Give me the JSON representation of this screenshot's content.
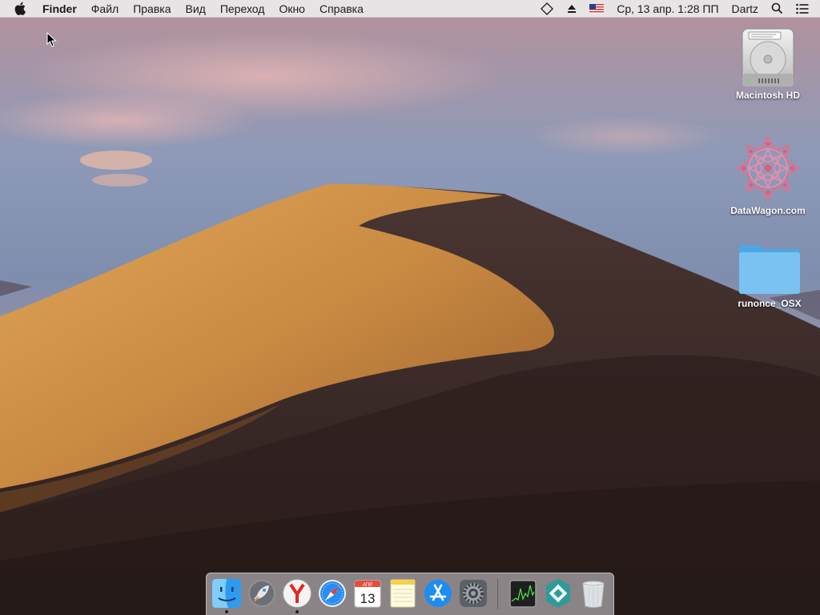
{
  "menubar": {
    "app_name": "Finder",
    "menus": [
      "Файл",
      "Правка",
      "Вид",
      "Переход",
      "Окно",
      "Справка"
    ],
    "status": {
      "datetime": "Ср, 13 апр.  1:28 ПП",
      "user": "Dartz",
      "icons": [
        "diamond-icon",
        "eject-icon",
        "us-flag-icon",
        "search-icon",
        "list-icon"
      ]
    }
  },
  "desktop_icons": [
    {
      "label": "Macintosh HD",
      "icon": "hard-drive-icon"
    },
    {
      "label": "DataWagon.com",
      "icon": "mandala-icon"
    },
    {
      "label": "runonce_OSX",
      "icon": "folder-icon"
    }
  ],
  "dock": {
    "items": [
      "finder",
      "launchpad",
      "yandex-browser",
      "safari",
      "calendar",
      "notes",
      "app-store",
      "system-preferences",
      "activity-monitor",
      "unknown-app",
      "trash"
    ],
    "calendar": {
      "month": "АПР",
      "day": "13"
    },
    "running": [
      "finder",
      "yandex-browser"
    ]
  },
  "colors": {
    "folder": "#79c2f2",
    "menubar": "#ececec",
    "dune": "#d49a4c"
  }
}
